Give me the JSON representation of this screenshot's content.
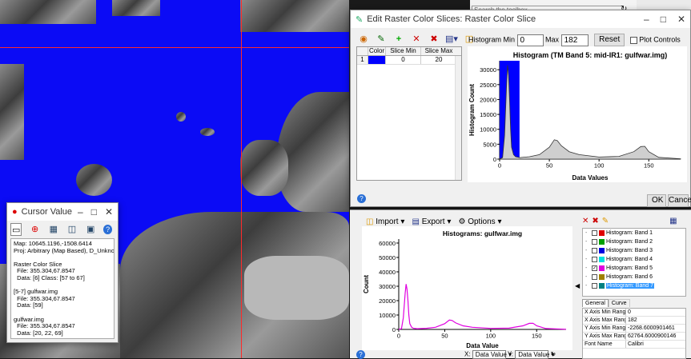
{
  "cursor_window": {
    "title": "Cursor Value",
    "lines": [
      "Map: 10645.1196,-1508.6414",
      "Proj: Arbitrary (Map Based), D_Unknown",
      "",
      "Raster Color Slice",
      "  File: 355.304,67.8547",
      "  Data: [6] Class: [57 to 67]",
      "",
      "[5-7] gulfwar.img",
      "  File: 355.304,67.8547",
      "  Data: [59]",
      "",
      "gulfwar.img",
      "  File: 355.304,67.8547",
      "  Data: [20, 22, 69]"
    ]
  },
  "toolbox": {
    "search_placeholder": "Search the toolbox"
  },
  "slice_dialog": {
    "title": "Edit Raster Color Slices: Raster Color Slice",
    "histogram_min_label": "Histogram Min",
    "histogram_min_value": "0",
    "max_label": "Max",
    "max_value": "182",
    "reset_label": "Reset",
    "plot_controls_label": "Plot Controls",
    "table_headers": [
      "Color",
      "Slice Min",
      "Slice Max"
    ],
    "table_rows": [
      {
        "index": "1",
        "color": "#0000ff",
        "slice_min": "0",
        "slice_max": "20"
      }
    ],
    "ok_label": "OK",
    "cancel_label": "Cancel"
  },
  "histogram_panel": {
    "import_label": "Import",
    "export_label": "Export",
    "options_label": "Options",
    "layers": [
      {
        "name": "Histogram: Band 1",
        "color": "#e00000",
        "checked": false
      },
      {
        "name": "Histogram: Band 2",
        "color": "#00a000",
        "checked": false
      },
      {
        "name": "Histogram: Band 3",
        "color": "#0000e0",
        "checked": false
      },
      {
        "name": "Histogram: Band 4",
        "color": "#00e0e0",
        "checked": false
      },
      {
        "name": "Histogram: Band 5",
        "color": "#e000e0",
        "checked": true
      },
      {
        "name": "Histogram: Band 6",
        "color": "#a08000",
        "checked": false
      },
      {
        "name": "Histogram: Band 7",
        "color": "#008080",
        "checked": false
      }
    ],
    "tabs": [
      "General",
      "Curve"
    ],
    "properties": [
      {
        "name": "X Axis Min Range",
        "value": "0"
      },
      {
        "name": "X Axis Max Range",
        "value": "182"
      },
      {
        "name": "Y Axis Min Range",
        "value": "-2268.6000901461"
      },
      {
        "name": "Y Axis Max Range",
        "value": "62764.6000900146"
      },
      {
        "name": "Font Name",
        "value": "Calibri"
      }
    ],
    "x_selector_label": "X:",
    "x_selector_value": "Data Value",
    "y_selector_label": "Y:",
    "y_selector_value": "Data Value"
  },
  "chart_data": [
    {
      "type": "area",
      "title": "Histogram (TM Band 5: mid-IR1: gulfwar.img)",
      "xlabel": "Data Values",
      "ylabel": "Histogram Count",
      "xlim": [
        0,
        182
      ],
      "ylim": [
        0,
        33000
      ],
      "xticks": [
        0,
        50,
        100,
        150
      ],
      "yticks": [
        0,
        5000,
        10000,
        15000,
        20000,
        25000,
        30000
      ],
      "highlight": {
        "from": 0,
        "to": 20,
        "color": "#0000ff"
      },
      "x": [
        0,
        3,
        5,
        7,
        8,
        9,
        10,
        11,
        12,
        14,
        16,
        20,
        30,
        40,
        50,
        55,
        58,
        62,
        70,
        80,
        100,
        120,
        135,
        142,
        146,
        150,
        160,
        182
      ],
      "y": [
        0,
        500,
        8000,
        25000,
        31500,
        28000,
        20000,
        10000,
        4000,
        1500,
        800,
        500,
        800,
        1500,
        4000,
        6500,
        6200,
        4500,
        2500,
        1500,
        700,
        900,
        2500,
        4200,
        4300,
        2500,
        600,
        100
      ]
    },
    {
      "type": "line",
      "title": "Histograms: gulfwar.img",
      "xlabel": "Data Value",
      "ylabel": "Count",
      "xlim": [
        0,
        182
      ],
      "ylim": [
        0,
        62764
      ],
      "xticks": [
        0,
        50,
        100,
        150
      ],
      "yticks": [
        0,
        10000,
        20000,
        30000,
        40000,
        50000,
        60000
      ],
      "series": [
        {
          "name": "Histogram: Band 5",
          "color": "#e000e0",
          "x": [
            0,
            3,
            5,
            7,
            8,
            9,
            10,
            11,
            12,
            14,
            16,
            20,
            30,
            40,
            50,
            55,
            58,
            62,
            70,
            80,
            100,
            120,
            135,
            142,
            146,
            150,
            160,
            182
          ],
          "y": [
            0,
            500,
            8000,
            25000,
            31500,
            28000,
            20000,
            10000,
            4000,
            1500,
            800,
            500,
            800,
            1500,
            4000,
            6500,
            6200,
            4500,
            2500,
            1500,
            700,
            900,
            2500,
            4200,
            4300,
            2500,
            600,
            100
          ]
        }
      ]
    }
  ]
}
